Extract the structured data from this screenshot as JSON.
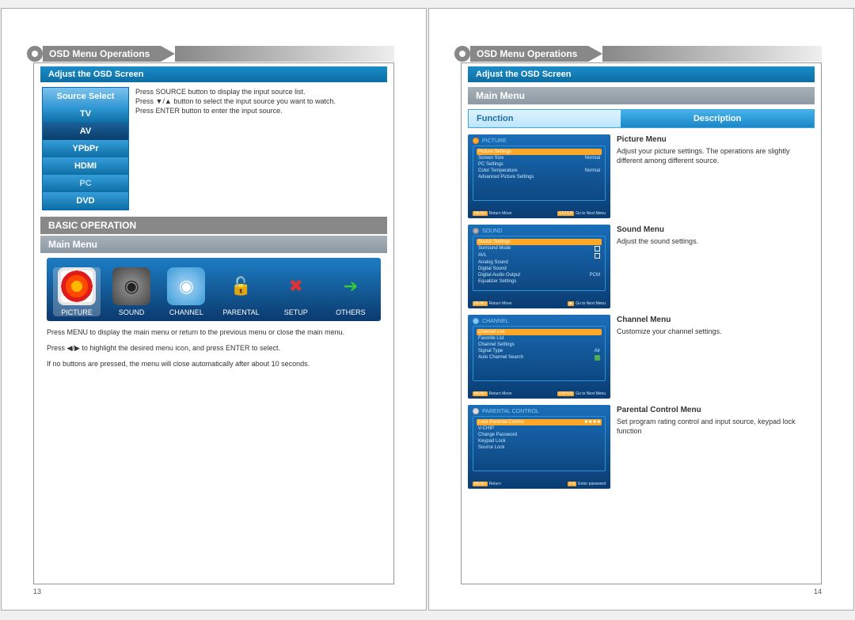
{
  "page": {
    "left_num": "13",
    "right_num": "14"
  },
  "header": {
    "title": "OSD Menu Operations"
  },
  "subbar": {
    "title": "Adjust the OSD Screen"
  },
  "source": {
    "head": "Source Select",
    "items": [
      "TV",
      "AV",
      "YPbPr",
      "HDMI",
      "PC",
      "DVD"
    ],
    "text1": "Press SOURCE button to display the input source list.",
    "text2a": "Press ",
    "text2b": " button to select the input source you want to watch.",
    "text3": "Press ENTER button to enter the input source."
  },
  "basic_op": "BASIC OPERATION",
  "mainmenu_bar": "Main Menu",
  "menu_icons": [
    "PICTURE",
    "SOUND",
    "CHANNEL",
    "PARENTAL",
    "SETUP",
    "OTHERS"
  ],
  "para1": "Press MENU to display the main menu or return to the previous menu or close the main menu.",
  "para2a": "Press ",
  "para2b": " to highlight the desired menu icon, and press ENTER to select.",
  "para3": "If no buttons are pressed, the menu will close automatically after about 10 seconds.",
  "fd": {
    "func": "Function",
    "desc": "Description"
  },
  "thumbs": {
    "picture": {
      "title": "PICTURE",
      "rows": [
        {
          "l": "Picture Settings",
          "r": "",
          "hl": true
        },
        {
          "l": "Screen Size",
          "r": "Normal"
        },
        {
          "l": "PC Settings",
          "r": ""
        },
        {
          "l": "Color Temperature",
          "r": "Normal"
        },
        {
          "l": "Advanced Picture Settings",
          "r": ""
        }
      ],
      "foot_l": "Return",
      "foot_m": "Move",
      "foot_r": "Go to Next Menu"
    },
    "sound": {
      "title": "SOUND",
      "rows": [
        {
          "l": "Sound Settings",
          "r": "",
          "hl": true
        },
        {
          "l": "Surround Mode",
          "r": "box"
        },
        {
          "l": "AVL",
          "r": "box"
        },
        {
          "l": "Analog Sound",
          "r": ""
        },
        {
          "l": "Digital Sound",
          "r": ""
        },
        {
          "l": "Digital Audio Output",
          "r": "PCM"
        },
        {
          "l": "Equalizer Settings",
          "r": ""
        }
      ],
      "foot_l": "Return",
      "foot_m": "Move",
      "foot_r": "Go to Next Menu"
    },
    "channel": {
      "title": "CHANNEL",
      "rows": [
        {
          "l": "Channel List",
          "r": "",
          "hl": true
        },
        {
          "l": "Favorite List",
          "r": ""
        },
        {
          "l": "Channel Settings",
          "r": ""
        },
        {
          "l": "Signal Type",
          "r": "Air"
        },
        {
          "l": "Auto Channel Search",
          "r": "boxg"
        }
      ],
      "foot_l": "Return",
      "foot_m": "Move",
      "foot_r": "Go to Next Menu"
    },
    "parental": {
      "title": "PARENTAL CONTROL",
      "rows": [
        {
          "l": "Lock Parental Control",
          "r": "■ ■ ■ ■",
          "hl": true
        },
        {
          "l": "V-CHIP",
          "r": ""
        },
        {
          "l": "Change Password",
          "r": ""
        },
        {
          "l": "Keypad Lock",
          "r": ""
        },
        {
          "l": "Source Lock",
          "r": ""
        }
      ],
      "foot_l": "Return",
      "foot_m": "Enter password",
      "foot_r": ""
    }
  },
  "desc": {
    "picture": {
      "t": "Picture Menu",
      "b": "Adjust your picture settings. The operations are slightly different among different source."
    },
    "sound": {
      "t": "Sound Menu",
      "b": "Adjust the sound settings."
    },
    "channel": {
      "t": "Channel  Menu",
      "b": "Customize your channel settings."
    },
    "parental": {
      "t": "Parental Control Menu",
      "b": "Set program rating control and input source, keypad lock function"
    }
  }
}
